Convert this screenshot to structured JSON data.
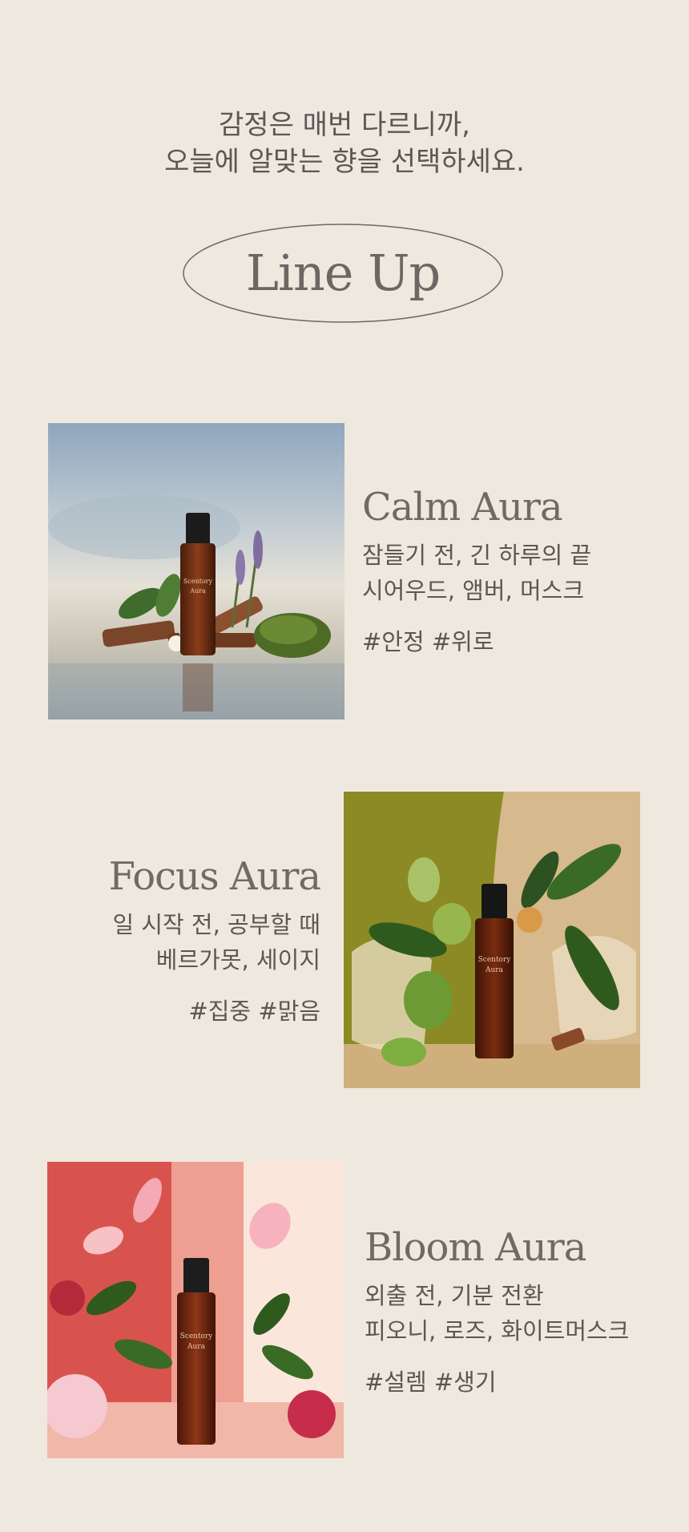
{
  "intro": {
    "line1": "감정은 매번 다르니까,",
    "line2": "오늘에 알맞는 향을 선택하세요."
  },
  "lineup": {
    "title": "Line Up"
  },
  "products": [
    {
      "name": "Calm Aura",
      "desc1": "잠들기 전, 긴 하루의 끝",
      "desc2": "시어우드, 앰버, 머스크",
      "tags": "#안정 #위로",
      "bottle_brand": "Scentory Aura"
    },
    {
      "name": "Focus Aura",
      "desc1": "일 시작 전, 공부할 때",
      "desc2": "베르가못, 세이지",
      "tags": "#집중 #맑음",
      "bottle_brand": "Scentory Aura"
    },
    {
      "name": "Bloom Aura",
      "desc1": "외출 전, 기분 전환",
      "desc2": "피오니, 로즈, 화이트머스크",
      "tags": "#설렘 #생기",
      "bottle_brand": "Scentory Aura"
    }
  ],
  "colors": {
    "background": "#efe8df",
    "text": "#5a5754",
    "heading": "#6e6a66"
  }
}
